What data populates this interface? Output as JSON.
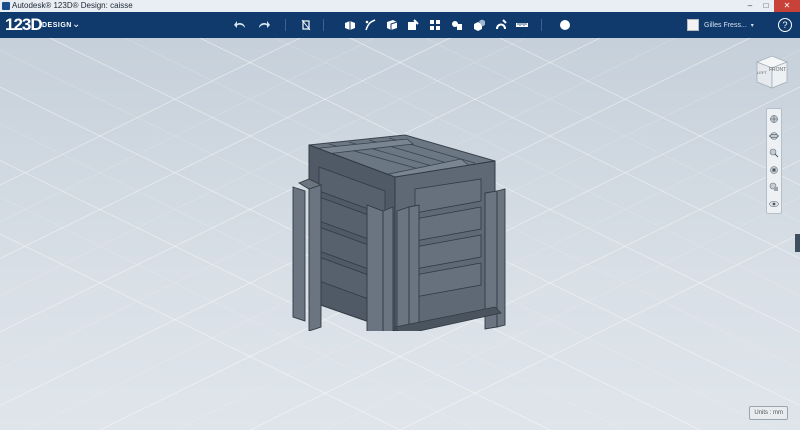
{
  "window": {
    "title": "Autodesk® 123D® Design: caisse",
    "controls": {
      "minimize": "–",
      "maximize": "□",
      "close": "✕"
    }
  },
  "app": {
    "logo": "123D",
    "logo_suffix": "DESIGN",
    "logo_menu_icon": "chevron-down-icon"
  },
  "toolbar": {
    "undo_icon": "undo-icon",
    "redo_icon": "redo-icon",
    "tools": [
      "transform-icon",
      "primitives-icon",
      "sketch-icon",
      "construct-icon",
      "modify-icon",
      "pattern-icon",
      "grouping-icon",
      "combine-icon",
      "snap-icon",
      "measure-icon",
      "material-icon"
    ]
  },
  "user": {
    "name": "Gilles Fress...",
    "help": "?"
  },
  "viewcube": {
    "front_label": "FRONT",
    "left_label": "LEFT"
  },
  "nav_tools": [
    "pan-icon",
    "orbit-icon",
    "zoom-icon",
    "fit-icon",
    "view-icon",
    "visibility-icon"
  ],
  "status": {
    "units": "Units : mm"
  },
  "colors": {
    "toolbar": "#0f3a6b",
    "crate": "#55616e",
    "viewport": "#cfd7df"
  }
}
